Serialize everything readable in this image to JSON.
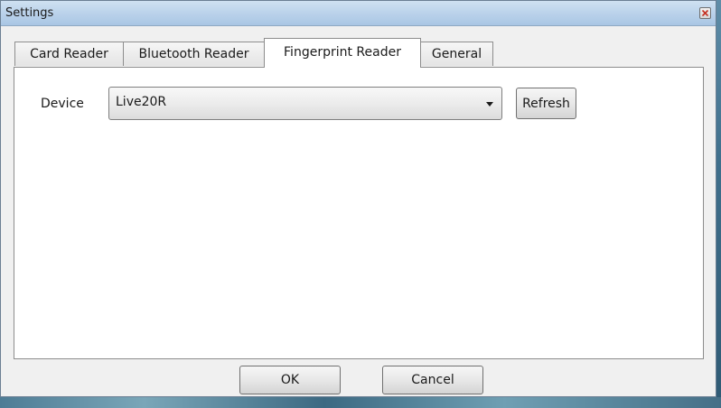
{
  "window": {
    "title": "Settings"
  },
  "tabs": [
    {
      "label": "Card Reader",
      "selected": false
    },
    {
      "label": "Bluetooth Reader",
      "selected": false
    },
    {
      "label": "Fingerprint Reader",
      "selected": true
    },
    {
      "label": "General",
      "selected": false
    }
  ],
  "fingerprint": {
    "device_label": "Device",
    "device_value": "Live20R",
    "refresh_label": "Refresh"
  },
  "footer": {
    "ok_label": "OK",
    "cancel_label": "Cancel"
  },
  "icons": {
    "close": "close-icon",
    "dropdown": "chevron-down-icon"
  },
  "colors": {
    "titlebar": "#b9d1ea",
    "window_bg": "#f0f0f0",
    "panel_bg": "#ffffff"
  }
}
